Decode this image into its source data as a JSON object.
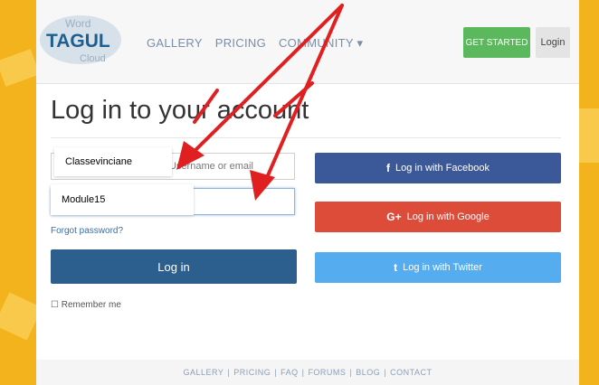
{
  "header": {
    "logo_text": "TAGUL",
    "logo_words": [
      "Word",
      "Cloud"
    ],
    "nav": [
      "GALLERY",
      "PRICING",
      "COMMUNITY ▾"
    ],
    "get_started": "GET STARTED",
    "login": "Login"
  },
  "main": {
    "title": "Log in to your account",
    "username_placeholder": "Username or email",
    "password_placeholder": "",
    "autofill_username": "Classevinciane",
    "autofill_password": "Module15",
    "forgot": "Forgot password?",
    "login_button": "Log in",
    "remember": "Remember me",
    "facebook": "Log in with Facebook",
    "google": "Log in with Google",
    "twitter": "Log in with Twitter",
    "facebook_icon": "f",
    "google_icon": "G+",
    "twitter_icon": "t"
  },
  "footer": {
    "links": [
      "GALLERY",
      "PRICING",
      "FAQ",
      "FORUMS",
      "BLOG",
      "CONTACT"
    ]
  },
  "colors": {
    "background": "#f2b31c",
    "facebook": "#3b5998",
    "google": "#dd4b39",
    "twitter": "#55acee",
    "login": "#2c5f8d",
    "start": "#5cb85c",
    "arrow": "#e02020"
  }
}
